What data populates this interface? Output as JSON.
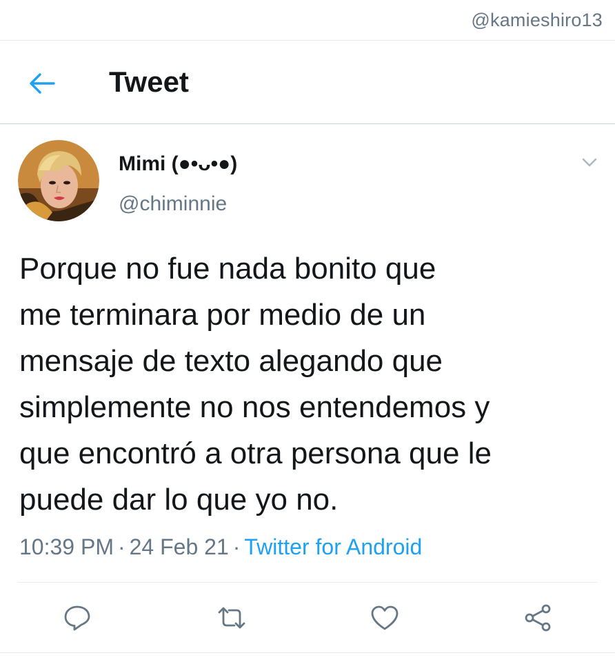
{
  "watermark": "@kamieshiro13",
  "header": {
    "back_icon": "arrow-left-icon",
    "title": "Tweet"
  },
  "tweet": {
    "author": {
      "display_name": "Mimi (●•ᴗ•●)",
      "handle": "@chiminnie",
      "avatar": "profile-photo"
    },
    "text": "Porque no fue nada bonito que\nme terminara por medio de un\nmensaje de texto alegando que\nsimplemente no nos entendemos y\nque encontró a otra persona que le\npuede dar lo que yo no.",
    "time": "10:39 PM",
    "date": "24 Feb 21",
    "separator": "·",
    "source": "Twitter for Android",
    "more_icon": "chevron-down-icon"
  },
  "actions": [
    {
      "icon": "reply-icon"
    },
    {
      "icon": "retweet-icon"
    },
    {
      "icon": "like-icon"
    },
    {
      "icon": "share-icon"
    }
  ],
  "colors": {
    "accent": "#1da1f2",
    "secondary_text": "#657786",
    "primary_text": "#14171a",
    "divider": "#e6ecf0"
  }
}
